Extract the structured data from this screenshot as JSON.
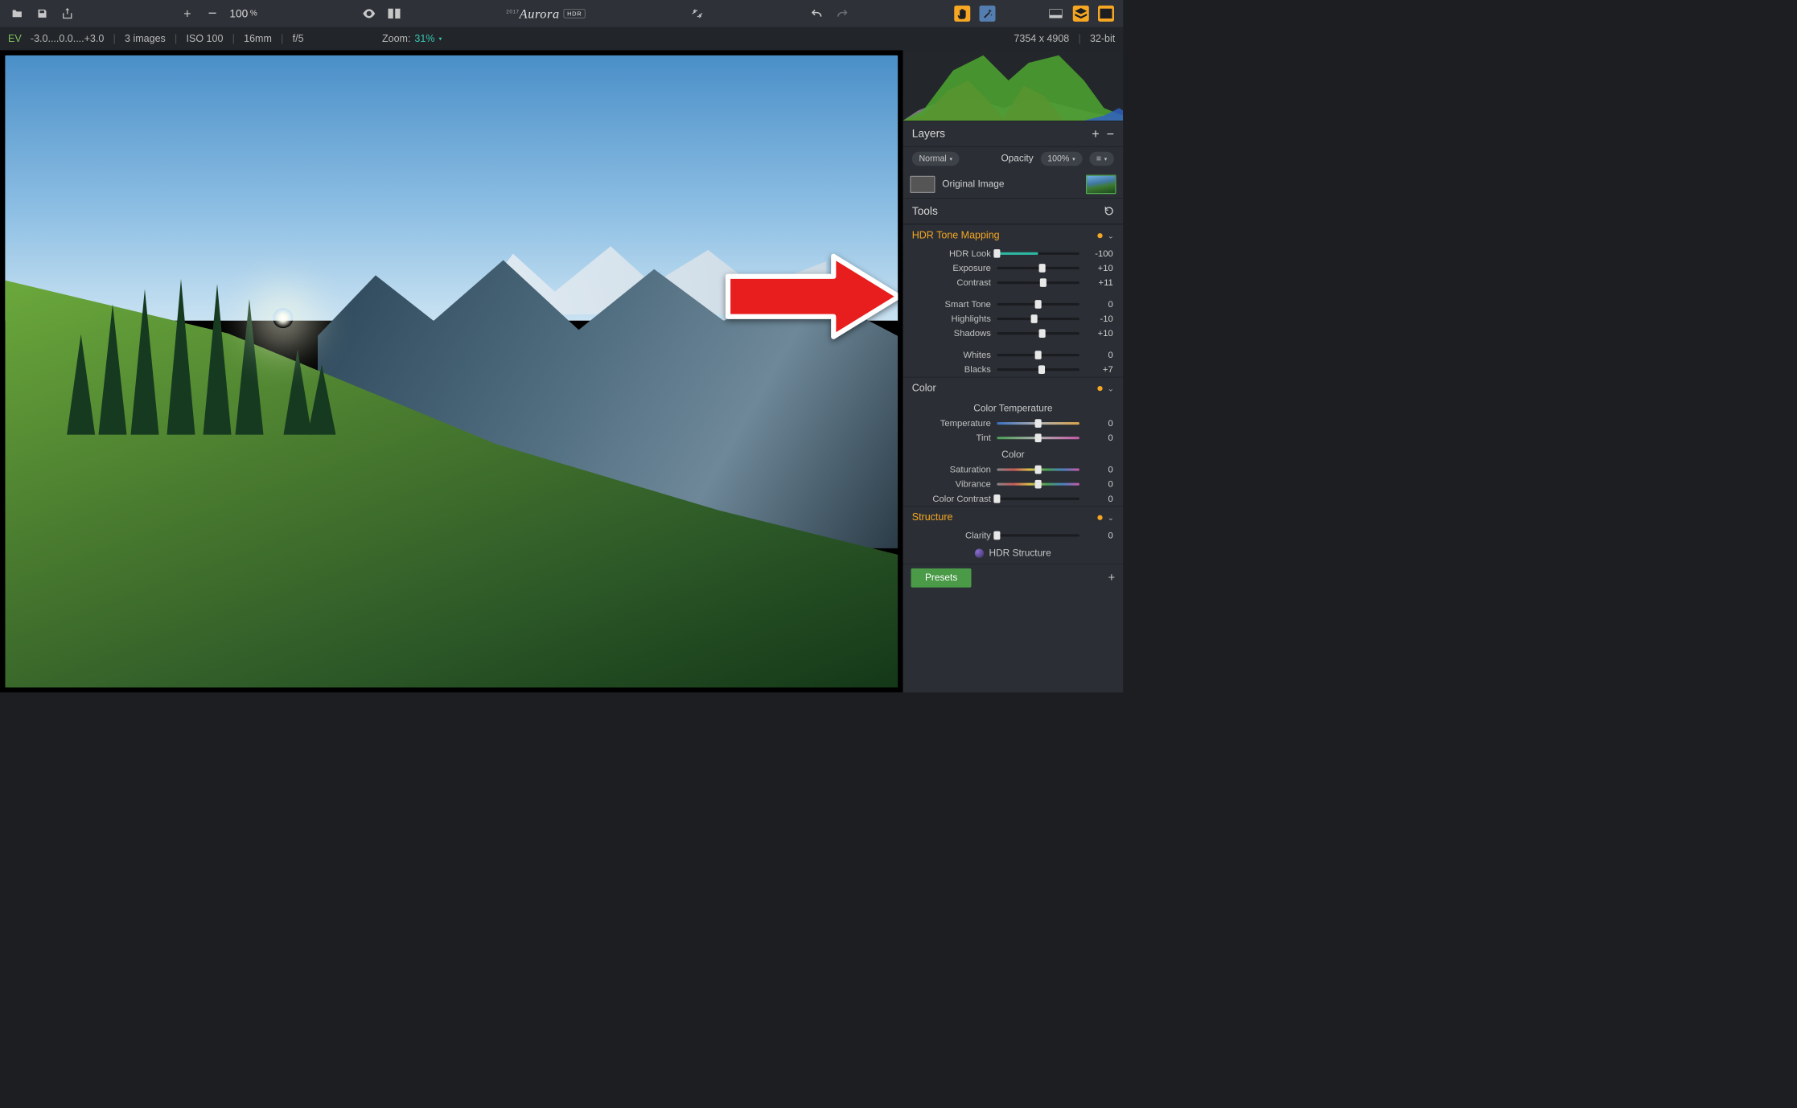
{
  "app": {
    "title_pre": "2017",
    "title": "Aurora",
    "title_badge": "HDR"
  },
  "topbar": {
    "zoom_default": "100",
    "zoom_suffix": "%"
  },
  "infobar": {
    "ev_label": "EV",
    "ev_values": "-3.0....0.0....+3.0",
    "images": "3 images",
    "iso": "ISO 100",
    "focal": "16mm",
    "aperture": "f/5",
    "zoom_label": "Zoom:",
    "zoom_value": "31%",
    "dimensions": "7354 x 4908",
    "bitdepth": "32-bit"
  },
  "layers": {
    "title": "Layers",
    "blend_mode": "Normal",
    "opacity_label": "Opacity",
    "opacity_value": "100%",
    "item_name": "Original Image"
  },
  "tools": {
    "title": "Tools"
  },
  "hdr_tone_mapping": {
    "title": "HDR Tone Mapping",
    "sliders": [
      {
        "label": "HDR Look",
        "value": "-100",
        "pos": 0,
        "fill_from": 0,
        "fill_to": 50,
        "fill": "teal"
      },
      {
        "label": "Exposure",
        "value": "+10",
        "pos": 55
      },
      {
        "label": "Contrast",
        "value": "+11",
        "pos": 56
      },
      {
        "gap": true
      },
      {
        "label": "Smart Tone",
        "value": "0",
        "pos": 50
      },
      {
        "label": "Highlights",
        "value": "-10",
        "pos": 45
      },
      {
        "label": "Shadows",
        "value": "+10",
        "pos": 55
      },
      {
        "gap": true
      },
      {
        "label": "Whites",
        "value": "0",
        "pos": 50
      },
      {
        "label": "Blacks",
        "value": "+7",
        "pos": 54
      }
    ]
  },
  "color": {
    "title": "Color",
    "sub_temp": "Color Temperature",
    "sub_color": "Color",
    "sliders_temp": [
      {
        "label": "Temperature",
        "value": "0",
        "pos": 50,
        "grad": "grad-temp"
      },
      {
        "label": "Tint",
        "value": "0",
        "pos": 50,
        "grad": "grad-tint"
      }
    ],
    "sliders_color": [
      {
        "label": "Saturation",
        "value": "0",
        "pos": 50,
        "grad": "grad-sat"
      },
      {
        "label": "Vibrance",
        "value": "0",
        "pos": 50,
        "grad": "grad-vib"
      },
      {
        "label": "Color Contrast",
        "value": "0",
        "pos": 0
      }
    ]
  },
  "structure": {
    "title": "Structure",
    "sliders": [
      {
        "label": "Clarity",
        "value": "0",
        "pos": 0
      }
    ],
    "hdr_structure_label": "HDR Structure"
  },
  "presets": {
    "label": "Presets"
  }
}
